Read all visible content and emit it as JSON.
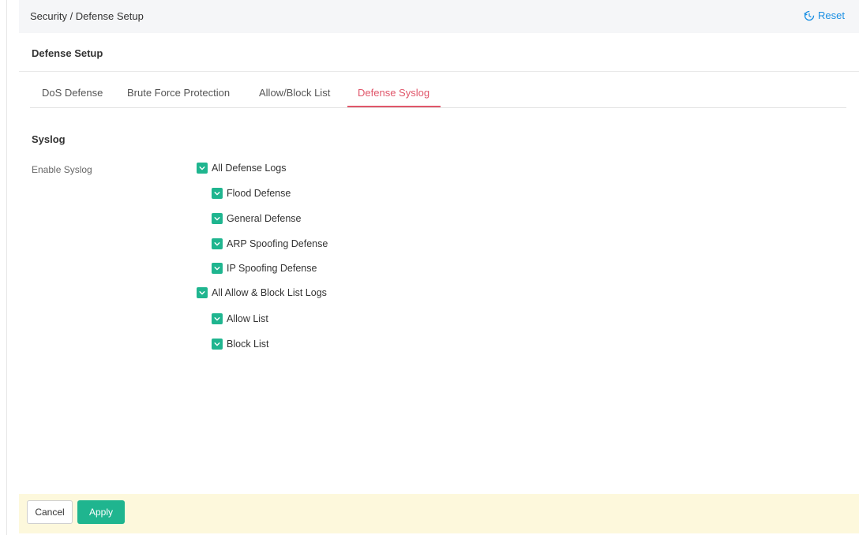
{
  "header": {
    "breadcrumb": "Security / Defense Setup",
    "reset_label": "Reset",
    "reset_icon": "history-icon"
  },
  "panel": {
    "title": "Defense Setup",
    "tabs": [
      {
        "label": "DoS Defense",
        "active": false
      },
      {
        "label": "Brute Force Protection",
        "active": false
      },
      {
        "label": "Allow/Block List",
        "active": false
      },
      {
        "label": "Defense Syslog",
        "active": true
      }
    ]
  },
  "syslog": {
    "section_title": "Syslog",
    "field_label": "Enable Syslog",
    "options": [
      {
        "label": "All Defense Logs",
        "checked": true,
        "level": 0
      },
      {
        "label": "Flood Defense",
        "checked": true,
        "level": 1
      },
      {
        "label": "General Defense",
        "checked": true,
        "level": 1
      },
      {
        "label": "ARP Spoofing Defense",
        "checked": true,
        "level": 1
      },
      {
        "label": "IP Spoofing Defense",
        "checked": true,
        "level": 1
      },
      {
        "label": "All Allow & Block List Logs",
        "checked": true,
        "level": 0
      },
      {
        "label": "Allow List",
        "checked": true,
        "level": 1
      },
      {
        "label": "Block List",
        "checked": true,
        "level": 1
      }
    ]
  },
  "footer": {
    "cancel_label": "Cancel",
    "apply_label": "Apply"
  },
  "colors": {
    "accent_green": "#1fb58f",
    "active_tab": "#e0566a",
    "link_blue": "#1a8fe3",
    "footer_bg": "#fdf8dc"
  }
}
